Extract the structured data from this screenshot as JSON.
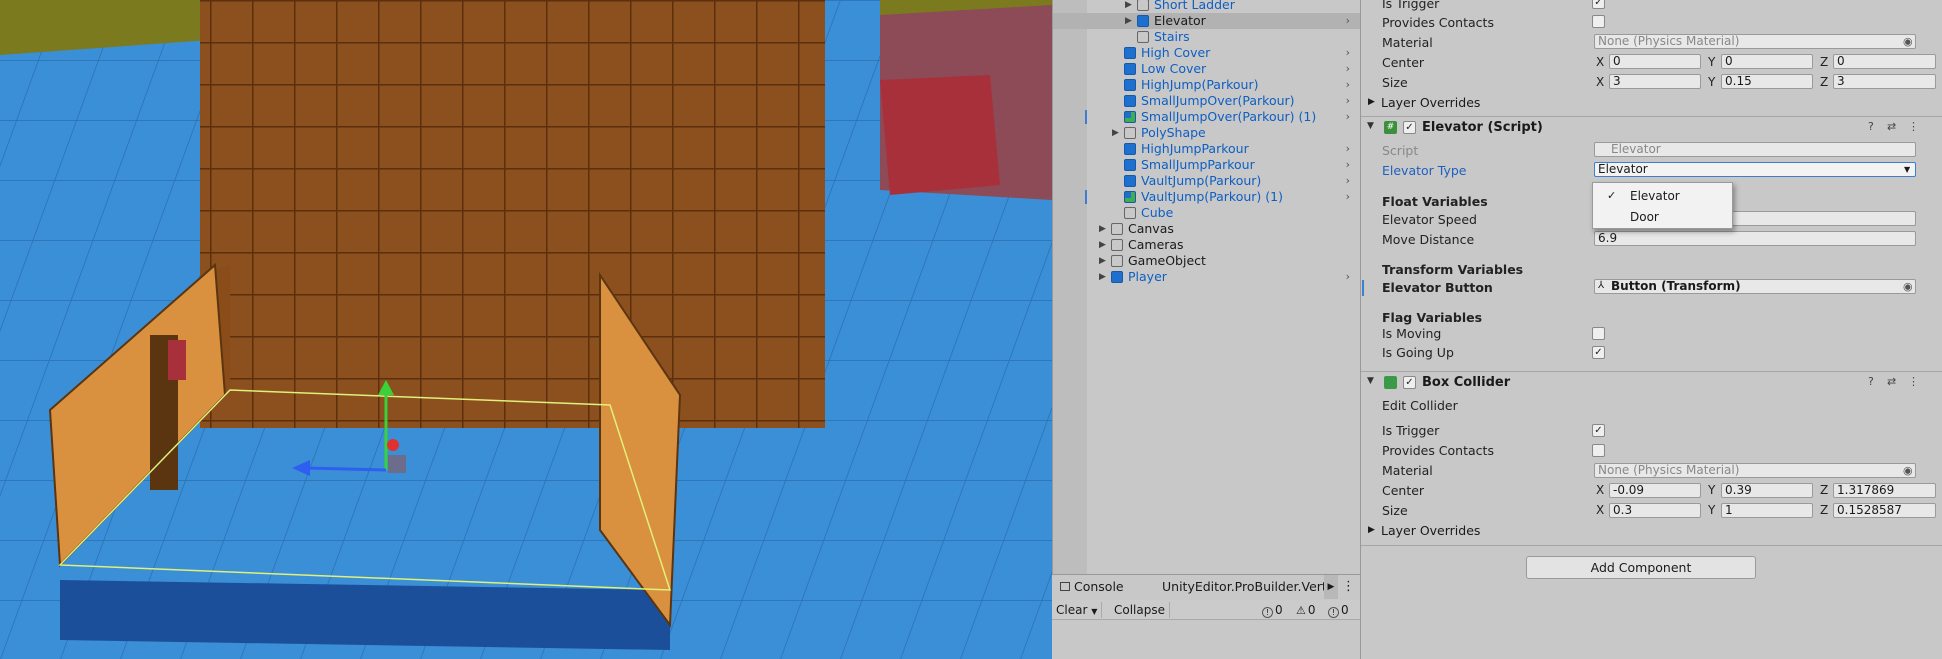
{
  "hierarchy": {
    "items": [
      {
        "label": "Short Ladder",
        "kind": "prefab",
        "icon": "cube-outline-icon",
        "arrow": "▶",
        "go": "",
        "bar": false,
        "selected": false
      },
      {
        "label": "Elevator",
        "kind": "plain",
        "icon": "prefab-blue-icon",
        "arrow": "▶",
        "go": "›",
        "bar": false,
        "selected": true
      },
      {
        "label": "Stairs",
        "kind": "prefab",
        "icon": "cube-outline-icon",
        "arrow": "",
        "go": "",
        "bar": false,
        "selected": false
      },
      {
        "label": "High Cover",
        "kind": "prefab",
        "icon": "prefab-blue-icon",
        "arrow": "",
        "go": "›",
        "bar": false,
        "selected": false
      },
      {
        "label": "Low Cover",
        "kind": "prefab",
        "icon": "prefab-blue-icon",
        "arrow": "",
        "go": "›",
        "bar": false,
        "selected": false
      },
      {
        "label": "HighJump(Parkour)",
        "kind": "prefab",
        "icon": "prefab-blue-icon",
        "arrow": "",
        "go": "›",
        "bar": false,
        "selected": false
      },
      {
        "label": "SmallJumpOver(Parkour)",
        "kind": "prefab",
        "icon": "prefab-blue-icon",
        "arrow": "",
        "go": "›",
        "bar": false,
        "selected": false
      },
      {
        "label": "SmallJumpOver(Parkour) (1)",
        "kind": "prefab",
        "icon": "prefab-variant-icon",
        "arrow": "",
        "go": "›",
        "bar": true,
        "selected": false
      },
      {
        "label": "PolyShape",
        "kind": "prefab",
        "icon": "cube-outline-icon",
        "arrow": "▶",
        "go": "",
        "bar": false,
        "selected": false
      },
      {
        "label": "HighJumpParkour",
        "kind": "prefab",
        "icon": "prefab-blue-icon",
        "arrow": "",
        "go": "›",
        "bar": false,
        "selected": false
      },
      {
        "label": "SmallJumpParkour",
        "kind": "prefab",
        "icon": "prefab-blue-icon",
        "arrow": "",
        "go": "›",
        "bar": false,
        "selected": false
      },
      {
        "label": "VaultJump(Parkour)",
        "kind": "prefab",
        "icon": "prefab-blue-icon",
        "arrow": "",
        "go": "›",
        "bar": false,
        "selected": false
      },
      {
        "label": "VaultJump(Parkour) (1)",
        "kind": "prefab",
        "icon": "prefab-variant-icon",
        "arrow": "",
        "go": "›",
        "bar": true,
        "selected": false
      },
      {
        "label": "Cube",
        "kind": "prefab",
        "icon": "cube-outline-icon",
        "arrow": "",
        "go": "",
        "bar": false,
        "selected": false
      },
      {
        "label": "Canvas",
        "kind": "plain",
        "icon": "cube-outline-icon",
        "arrow": "▶",
        "go": "",
        "bar": false,
        "selected": false
      },
      {
        "label": "Cameras",
        "kind": "plain",
        "icon": "cube-outline-icon",
        "arrow": "▶",
        "go": "",
        "bar": false,
        "selected": false
      },
      {
        "label": "GameObject",
        "kind": "plain",
        "icon": "cube-outline-icon",
        "arrow": "▶",
        "go": "",
        "bar": false,
        "selected": false
      },
      {
        "label": "Player",
        "kind": "prefab",
        "icon": "prefab-blue-icon",
        "arrow": "▶",
        "go": "›",
        "bar": false,
        "selected": false
      }
    ]
  },
  "console": {
    "tab_console": "Console",
    "tab_other": "UnityEditor.ProBuilder.Verte",
    "clear": "Clear",
    "collapse": "Collapse",
    "errors": "0",
    "warnings": "0",
    "infos": "0"
  },
  "inspector": {
    "top_collider": {
      "is_trigger": "Is Trigger",
      "provides_contacts": "Provides Contacts",
      "material": "Material",
      "material_value": "None (Physics Material)",
      "center": "Center",
      "center_x": "0",
      "center_y": "0",
      "center_z": "0",
      "size": "Size",
      "size_x": "3",
      "size_y": "0.15",
      "size_z": "3",
      "layer_overrides": "Layer Overrides"
    },
    "elevator_script": {
      "title": "Elevator (Script)",
      "script_label": "Script",
      "script_value": "Elevator",
      "type_label": "Elevator Type",
      "type_value": "Elevator",
      "float_header": "Float Variables",
      "speed_label": "Elevator Speed",
      "speed_value": "",
      "move_label": "Move Distance",
      "move_value": "6.9",
      "transform_header": "Transform Variables",
      "button_label": "Elevator Button",
      "button_value": "Button (Transform)",
      "flag_header": "Flag Variables",
      "moving_label": "Is Moving",
      "going_up_label": "Is Going Up"
    },
    "dropdown": {
      "options": [
        "Elevator",
        "Door"
      ]
    },
    "box_collider": {
      "title": "Box Collider",
      "edit_collider": "Edit Collider",
      "is_trigger": "Is Trigger",
      "provides_contacts": "Provides Contacts",
      "material": "Material",
      "material_value": "None (Physics Material)",
      "center": "Center",
      "center_x": "-0.09",
      "center_y": "0.39",
      "center_z": "1.317869",
      "size": "Size",
      "size_x": "0.3",
      "size_y": "1",
      "size_z": "0.1528587",
      "layer_overrides": "Layer Overrides"
    },
    "add_component": "Add Component",
    "axis_x": "X",
    "axis_y": "Y",
    "axis_z": "Z"
  },
  "colors": {
    "ground": "#3b8fd6",
    "crate": "#8a4c18",
    "wall": "#d9913f",
    "prefab_text": "#0e5fc2"
  }
}
